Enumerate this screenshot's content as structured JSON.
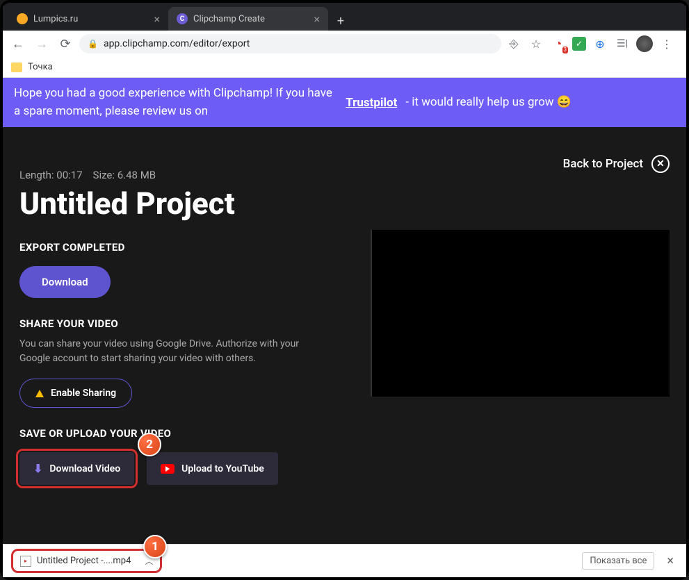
{
  "window": {
    "tabs": [
      {
        "title": "Lumpics.ru"
      },
      {
        "title": "Clipchamp Create"
      }
    ]
  },
  "toolbar": {
    "url": "app.clipchamp.com/editor/export",
    "ext_badge": "3"
  },
  "bookmarks": {
    "item1": "Точка"
  },
  "banner": {
    "left": "Hope you had a good experience with Clipchamp! If you have a spare moment, please review us on",
    "link": "Trustpilot",
    "right": "- it would really help us grow 😄"
  },
  "page": {
    "back": "Back to Project",
    "length_label": "Length:",
    "length_val": "00:17",
    "size_label": "Size:",
    "size_val": "6.48 MB",
    "title": "Untitled Project",
    "export_label": "EXPORT COMPLETED",
    "download_btn": "Download",
    "share_label": "SHARE YOUR VIDEO",
    "share_desc": "You can share your video using Google Drive. Authorize with your Google account to start sharing your video with others.",
    "enable_btn": "Enable Sharing",
    "save_label": "SAVE OR UPLOAD YOUR VIDEO",
    "download_video": "Download Video",
    "upload_yt": "Upload to YouTube"
  },
  "badges": {
    "n1": "1",
    "n2": "2"
  },
  "downloads": {
    "file": "Untitled Project -....mp4",
    "show_all": "Показать все"
  }
}
